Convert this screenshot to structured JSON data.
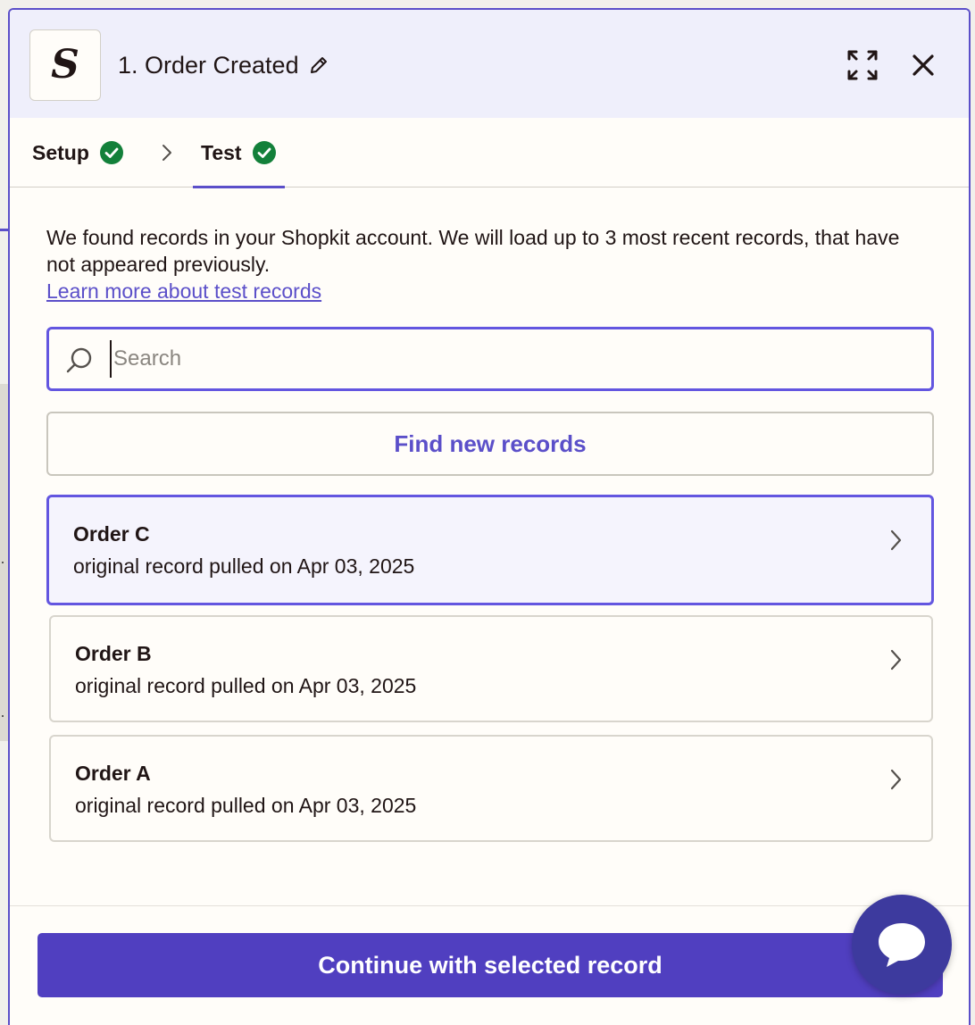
{
  "header": {
    "title": "1. Order Created",
    "logo_letter": "S",
    "icons": [
      "pencil-icon",
      "expand-icon",
      "close-icon"
    ]
  },
  "tabs": [
    {
      "label": "Setup",
      "status": "complete"
    },
    {
      "label": "Test",
      "status": "complete",
      "active": true
    }
  ],
  "intro": {
    "text": "We found records in your Shopkit account. We will load up to 3 most recent records, that have not appeared previously.",
    "link": "Learn more about test records"
  },
  "search": {
    "placeholder": "Search",
    "value": ""
  },
  "find_button": "Find new records",
  "records": [
    {
      "title": "Order C",
      "subtitle": "original record pulled on Apr 03, 2025",
      "selected": true
    },
    {
      "title": "Order B",
      "subtitle": "original record pulled on Apr 03, 2025",
      "selected": false
    },
    {
      "title": "Order A",
      "subtitle": "original record pulled on Apr 03, 2025",
      "selected": false
    }
  ],
  "continue_button": "Continue with selected record",
  "colors": {
    "accent": "#5b4fc9",
    "primary_button": "#503fc0",
    "success": "#13803a",
    "header_bg": "#efeffb",
    "chat_bubble": "#3d3a9e"
  }
}
